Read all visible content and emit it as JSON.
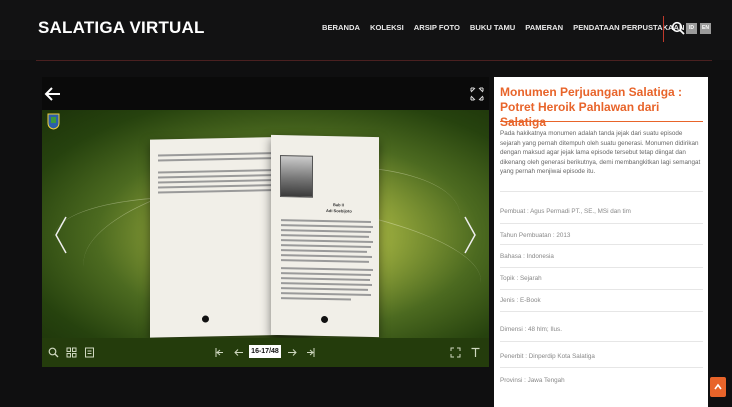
{
  "header": {
    "brand": "SALATIGA VIRTUAL",
    "menu": [
      "BERANDA",
      "KOLEKSI",
      "ARSIP FOTO",
      "BUKU TAMU",
      "PAMERAN",
      "PENDATAAN PERPUSTAKAAN"
    ],
    "lang": [
      "ID",
      "EN"
    ],
    "accent": "#c0392b"
  },
  "viewer": {
    "page_indicator": "16-17/48",
    "right_page_heading": "Bab II",
    "right_page_subheading": "Adi Soebijoto",
    "stage_colors": [
      "#e8e270",
      "#4c6a20",
      "#1c320a"
    ],
    "toolbar_color": "#243c0c"
  },
  "detail": {
    "title": "Monumen Perjuangan Salatiga : Potret Heroik Pahlawan dari Salatiga",
    "description": "Pada hakikatnya monumen adalah tanda jejak dari suatu episode sejarah yang pernah ditempuh oleh suatu generasi. Monumen didirikan dengan maksud agar jejak lama episode tersebut tetap diingat dan dikenang oleh generasi berikutnya, demi membangkitkan lagi semangat yang pernah menjiwai episode itu.",
    "meta": [
      "Pembuat : Agus Permadi PT., SE., MSi dan tim",
      "Tahun Pembuatan : 2013",
      "Bahasa : Indonesia",
      "Topik : Sejarah",
      "Jenis : E-Book",
      "Dimensi : 48 hlm; Ilus.",
      "Penerbit : Dinperdip Kota Salatiga",
      "Provinsi : Jawa Tengah"
    ],
    "accent": "#e8642a"
  }
}
